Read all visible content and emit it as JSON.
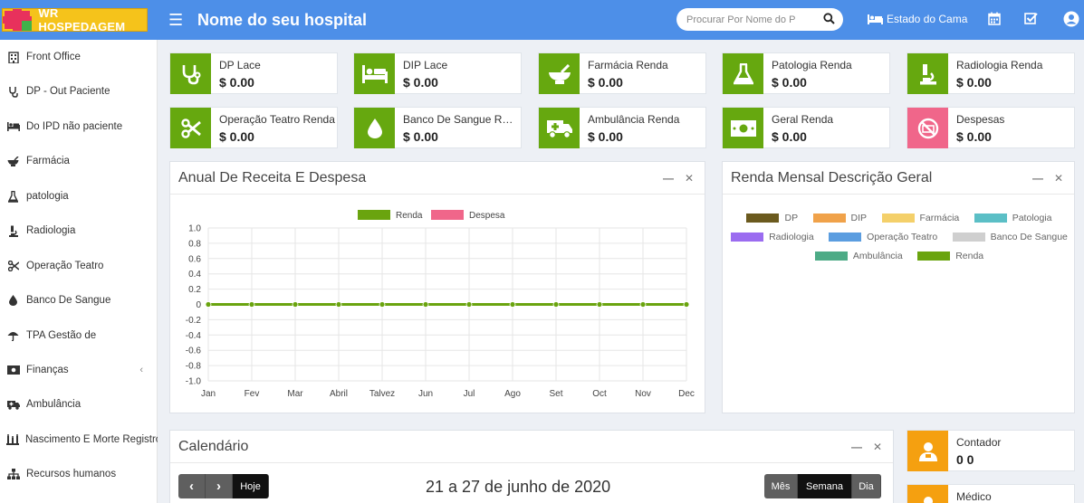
{
  "brand": {
    "name": "WR HOSPEDAGEM"
  },
  "header": {
    "title": "Nome do seu hospital",
    "search_placeholder": "Procurar Por Nome do P",
    "bed_status": "Estado do Cama"
  },
  "sidebar": {
    "items": [
      {
        "label": "Front Office",
        "icon": "building-icon"
      },
      {
        "label": "DP - Out Paciente",
        "icon": "stethoscope-icon"
      },
      {
        "label": "Do IPD não paciente",
        "icon": "bed-icon"
      },
      {
        "label": "Farmácia",
        "icon": "mortar-icon"
      },
      {
        "label": "patologia",
        "icon": "flask-icon"
      },
      {
        "label": "Radiologia",
        "icon": "microscope-icon"
      },
      {
        "label": "Operação Teatro",
        "icon": "scissors-icon"
      },
      {
        "label": "Banco De Sangue",
        "icon": "drop-icon"
      },
      {
        "label": "TPA Gestão de",
        "icon": "umbrella-icon"
      },
      {
        "label": "Finanças",
        "icon": "money-icon"
      },
      {
        "label": "Ambulância",
        "icon": "ambulance-icon"
      },
      {
        "label": "Nascimento E Morte Registro",
        "icon": "family-icon"
      },
      {
        "label": "Recursos humanos",
        "icon": "sitemap-icon"
      }
    ]
  },
  "stats": [
    {
      "label": "DP Lace",
      "value": "$ 0.00",
      "color": "#66a80f",
      "icon": "stethoscope-icon"
    },
    {
      "label": "DIP Lace",
      "value": "$ 0.00",
      "color": "#66a80f",
      "icon": "bed-icon"
    },
    {
      "label": "Farmácia Renda",
      "value": "$ 0.00",
      "color": "#66a80f",
      "icon": "mortar-icon"
    },
    {
      "label": "Patologia Renda",
      "value": "$ 0.00",
      "color": "#66a80f",
      "icon": "flask-icon"
    },
    {
      "label": "Radiologia Renda",
      "value": "$ 0.00",
      "color": "#66a80f",
      "icon": "microscope-icon"
    },
    {
      "label": "Operação Teatro Renda",
      "value": "$ 0.00",
      "color": "#66a80f",
      "icon": "scissors-icon"
    },
    {
      "label": "Banco De Sangue Renda",
      "value": "$ 0.00",
      "color": "#66a80f",
      "icon": "drop-icon"
    },
    {
      "label": "Ambulância Renda",
      "value": "$ 0.00",
      "color": "#66a80f",
      "icon": "ambulance-icon"
    },
    {
      "label": "Geral Renda",
      "value": "$ 0.00",
      "color": "#66a80f",
      "icon": "money-icon"
    },
    {
      "label": "Despesas",
      "value": "$ 0.00",
      "color": "#f0668a",
      "icon": "no-money-icon"
    }
  ],
  "annual_panel": {
    "title": "Anual De Receita E Despesa"
  },
  "monthly_panel": {
    "title": "Renda Mensal Descrição Geral",
    "legend": [
      {
        "label": "DP",
        "color": "#6b5a1e"
      },
      {
        "label": "DIP",
        "color": "#f0a24a"
      },
      {
        "label": "Farmácia",
        "color": "#f4d06a"
      },
      {
        "label": "Patologia",
        "color": "#5bbfc6"
      },
      {
        "label": "Radiologia",
        "color": "#9b6cf0"
      },
      {
        "label": "Operação Teatro",
        "color": "#5b9de0"
      },
      {
        "label": "Banco De Sangue",
        "color": "#cfcfcf"
      },
      {
        "label": "Ambulância",
        "color": "#4dab86"
      },
      {
        "label": "Renda",
        "color": "#6aa40f"
      }
    ]
  },
  "chart_data": {
    "type": "line",
    "categories": [
      "Jan",
      "Fev",
      "Mar",
      "Abril",
      "Talvez",
      "Jun",
      "Jul",
      "Ago",
      "Set",
      "Oct",
      "Nov",
      "Dec"
    ],
    "series": [
      {
        "name": "Renda",
        "color": "#6aa40f",
        "values": [
          0,
          0,
          0,
          0,
          0,
          0,
          0,
          0,
          0,
          0,
          0,
          0
        ]
      },
      {
        "name": "Despesa",
        "color": "#f0668a",
        "values": [
          0,
          0,
          0,
          0,
          0,
          0,
          0,
          0,
          0,
          0,
          0,
          0
        ]
      }
    ],
    "yticks": [
      "1.0",
      "0.8",
      "0.6",
      "0.4",
      "0.2",
      "0",
      "-0.2",
      "-0.4",
      "-0.6",
      "-0.8",
      "-1.0"
    ],
    "ylim": [
      -1,
      1
    ],
    "legend_position": "top"
  },
  "calendar": {
    "title": "Calendário",
    "today": "Hoje",
    "range": "21 a 27 de junho de 2020",
    "views": [
      "Mês",
      "Semana",
      "Dia"
    ],
    "active_view": "Semana"
  },
  "side_cards": [
    {
      "label": "Contador",
      "value": "0 0",
      "icon": "user-icon"
    },
    {
      "label": "Médico",
      "value": "",
      "icon": "user-icon"
    }
  ]
}
